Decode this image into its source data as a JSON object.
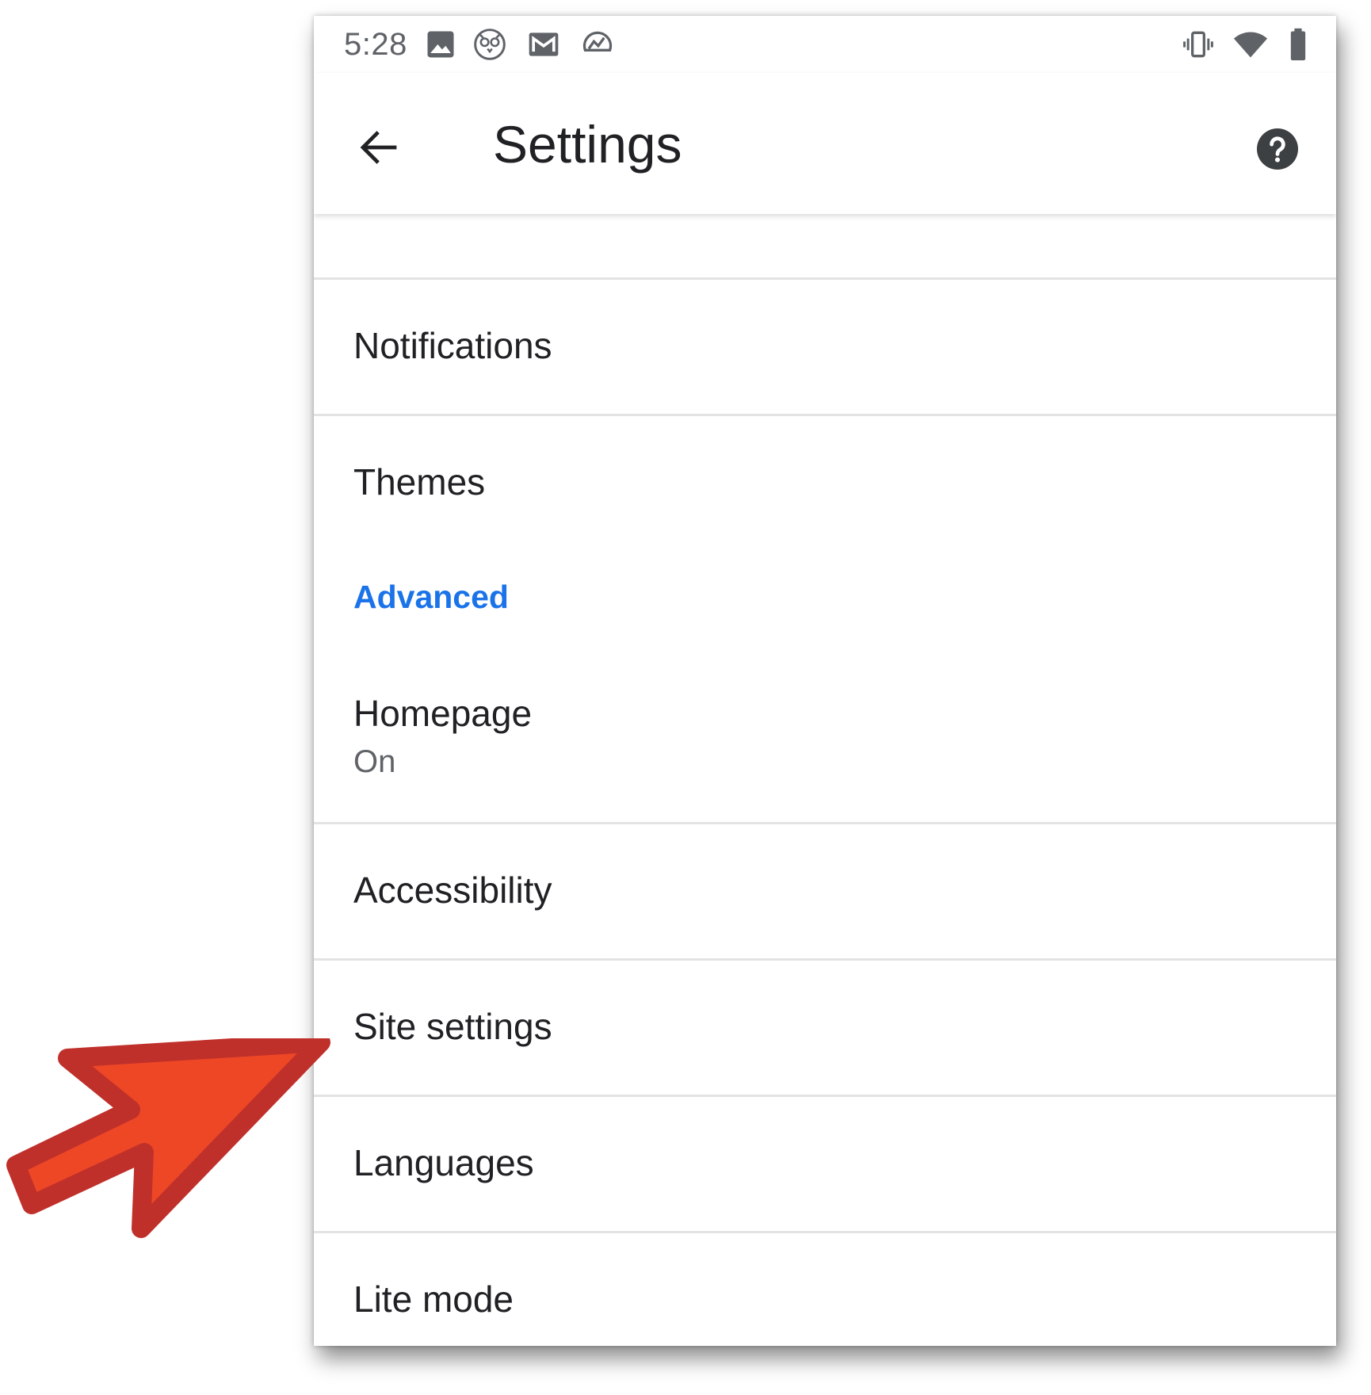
{
  "status_bar": {
    "time": "5:28",
    "left_icons": [
      "image-icon",
      "owl-icon",
      "gmail-icon",
      "analytics-icon"
    ],
    "right_icons": [
      "vibrate-icon",
      "wifi-icon",
      "battery-icon"
    ]
  },
  "app_bar": {
    "title": "Settings",
    "back_icon": "arrow-back-icon",
    "help_icon": "help-icon"
  },
  "settings": {
    "items": [
      {
        "label": "Notifications"
      },
      {
        "label": "Themes"
      }
    ],
    "advanced_header": "Advanced",
    "advanced_items": [
      {
        "label": "Homepage",
        "summary": "On"
      },
      {
        "label": "Accessibility"
      },
      {
        "label": "Site settings"
      },
      {
        "label": "Languages"
      },
      {
        "label": "Lite mode"
      }
    ]
  },
  "annotation": {
    "pointer_icon": "red-arrow-icon",
    "target": "Site settings"
  },
  "colors": {
    "accent": "#1a73e8",
    "text_primary": "#202124",
    "text_secondary": "#5f6368",
    "divider": "#e3e3e3",
    "arrow_fill": "#ee4726",
    "arrow_stroke": "#c0302b"
  }
}
